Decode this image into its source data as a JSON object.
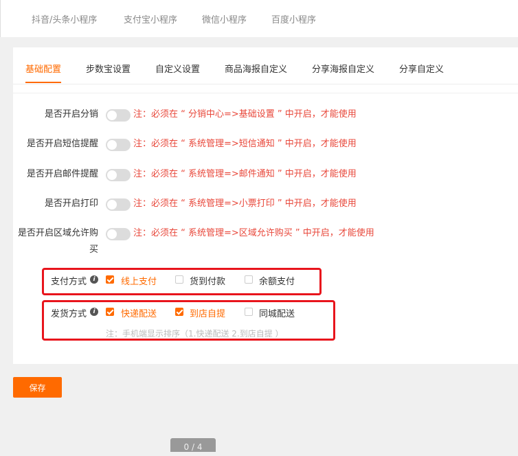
{
  "top_tabs": [
    "抖音/头条小程序",
    "支付宝小程序",
    "微信小程序",
    "百度小程序"
  ],
  "sub_tabs": [
    "基础配置",
    "步数宝设置",
    "自定义设置",
    "商品海报自定义",
    "分享海报自定义",
    "分享自定义"
  ],
  "active_sub_tab": "基础配置",
  "toggles": [
    {
      "label": "是否开启分销",
      "enabled": false,
      "note": "注：必须在 “ 分销中心=>基础设置 ” 中开启，才能使用"
    },
    {
      "label": "是否开启短信提醒",
      "enabled": false,
      "note": "注：必须在 “ 系统管理=>短信通知 ” 中开启，才能使用"
    },
    {
      "label": "是否开启邮件提醒",
      "enabled": false,
      "note": "注：必须在 “ 系统管理=>邮件通知 ” 中开启，才能使用"
    },
    {
      "label": "是否开启打印",
      "enabled": false,
      "note": "注：必须在 “ 系统管理=>小票打印 ” 中开启，才能使用"
    },
    {
      "label_line1": "是否开启区域允许购",
      "label_line2": "买",
      "enabled": false,
      "note": "注：必须在 “ 系统管理=>区域允许购买 ” 中开启，才能使用"
    }
  ],
  "payment": {
    "label": "支付方式",
    "info_icon": "i",
    "options": [
      {
        "label": "线上支付",
        "checked": true
      },
      {
        "label": "货到付款",
        "checked": false
      },
      {
        "label": "余额支付",
        "checked": false
      }
    ]
  },
  "delivery": {
    "label": "发货方式",
    "info_icon": "i",
    "options": [
      {
        "label": "快递配送",
        "checked": true
      },
      {
        "label": "到店自提",
        "checked": true
      },
      {
        "label": "同城配送",
        "checked": false
      }
    ],
    "hint": "注：手机端显示排序（1.快递配送 2.到店自提 ）"
  },
  "save_label": "保存",
  "pager_text": "0 / 4",
  "colors": {
    "accent": "#ff6a00",
    "note_red": "#e8473a",
    "highlight_box": "#e8141c"
  }
}
